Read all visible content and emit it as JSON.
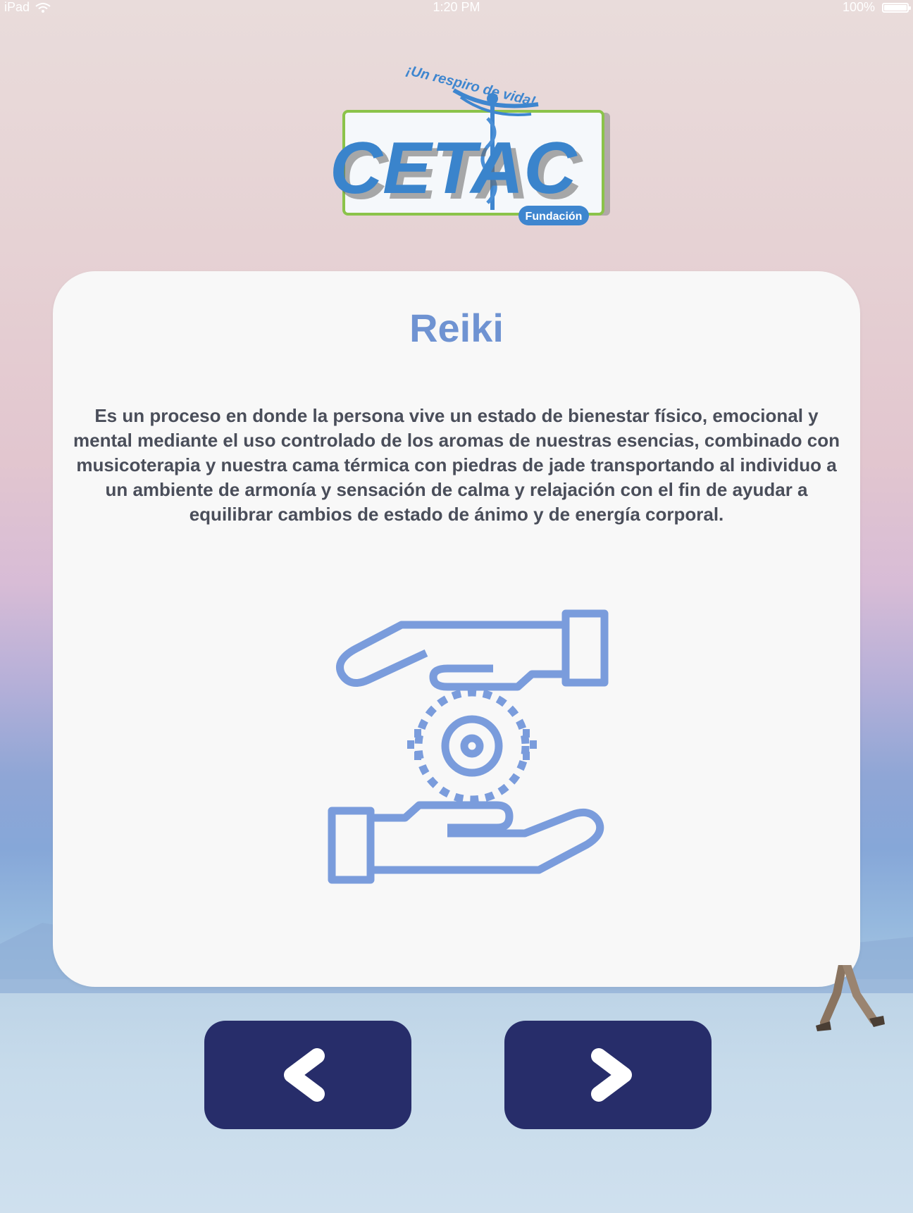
{
  "status_bar": {
    "device": "iPad",
    "time": "1:20 PM",
    "battery": "100%"
  },
  "logo": {
    "brand": "CETAC",
    "tagline": "¡Un respiro de vida!",
    "subtitle": "Fundación"
  },
  "card": {
    "title": "Reiki",
    "description": "Es un proceso en donde la persona vive un estado de bienestar físico, emocional y mental mediante el uso controlado de los aromas de nuestras esencias, combinado con musicoterapia y nuestra cama térmica con piedras de jade transportando al individuo a un ambiente de armonía y sensación de calma y relajación con el fin de ayudar a equilibrar cambios de estado de ánimo y de energía corporal.",
    "icon": "reiki-hands-icon"
  },
  "navigation": {
    "prev_icon": "chevron-left-icon",
    "next_icon": "chevron-right-icon"
  },
  "colors": {
    "accent": "#6f93d2",
    "button": "#272d6a",
    "text": "#4a4e5a",
    "card": "#f8f8f8"
  }
}
